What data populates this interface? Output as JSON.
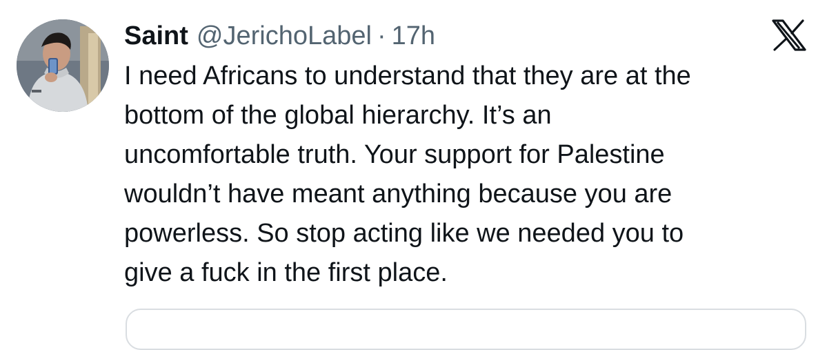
{
  "tweet": {
    "display_name": "Saint",
    "handle": "@JerichoLabel",
    "separator": "·",
    "time": "17h",
    "text": "I need Africans to understand that they are at the\nbottom of the global hierarchy. It’s an\nuncomfortable truth. Your support for Palestine\nwouldn’t have meant anything because you are\npowerless. So stop acting like we needed you to\ngive a fuck in the first place."
  },
  "icons": {
    "avatar": "user-avatar-photo",
    "platform_logo": "x-logo-icon"
  },
  "colors": {
    "text_primary": "#0f1419",
    "text_secondary": "#536471",
    "border": "#d9dde1",
    "background": "#ffffff"
  }
}
